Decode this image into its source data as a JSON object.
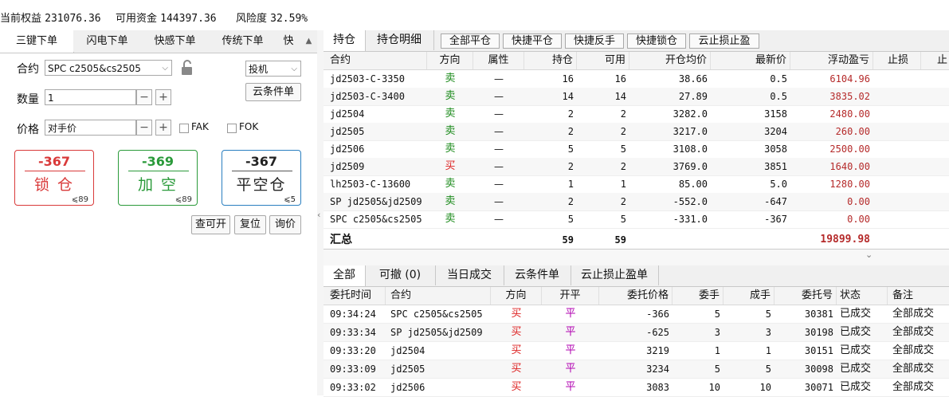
{
  "topbar": {
    "equity_label": "当前权益",
    "equity_value": "231076.36",
    "available_label": "可用资金",
    "available_value": "144397.36",
    "risk_label": "风险度",
    "risk_value": "32.59%"
  },
  "order_panel": {
    "tabs": [
      "三键下单",
      "闪电下单",
      "快感下单",
      "传统下单",
      "快"
    ],
    "contract_label": "合约",
    "contract_value": "SPC c2505&cs2505",
    "hedge_value": "投机",
    "cloud_button": "云条件单",
    "qty_label": "数量",
    "qty_value": "1",
    "price_label": "价格",
    "price_value": "对手价",
    "fak_label": "FAK",
    "fok_label": "FOK",
    "lock_btn": {
      "price": "-367",
      "name": "锁 仓",
      "qty": "⩽89"
    },
    "short_btn": {
      "price": "-369",
      "name": "加 空",
      "qty": "⩽89"
    },
    "close_btn": {
      "price": "-367",
      "name": "平空仓",
      "qty": "⩽5"
    },
    "check_button": "查可开",
    "reset_button": "复位",
    "query_button": "询价",
    "colors": {
      "lock": "#d93a3a",
      "short": "#2a9a3a",
      "close": "#2a7fc0"
    }
  },
  "positions": {
    "tabs": [
      "持仓",
      "持仓明细"
    ],
    "toolbar": [
      "全部平仓",
      "快捷平仓",
      "快捷反手",
      "快捷锁仓",
      "云止损止盈"
    ],
    "headers": [
      "合约",
      "方向",
      "属性",
      "持仓",
      "可用",
      "开仓均价",
      "最新价",
      "浮动盈亏",
      "止损",
      "止"
    ],
    "rows": [
      {
        "contract": "jd2503-C-3350",
        "dir": "卖",
        "attr": "—",
        "pos": "16",
        "avail": "16",
        "avg": "38.66",
        "last": "0.5",
        "pnl": "6104.96"
      },
      {
        "contract": "jd2503-C-3400",
        "dir": "卖",
        "attr": "—",
        "pos": "14",
        "avail": "14",
        "avg": "27.89",
        "last": "0.5",
        "pnl": "3835.02"
      },
      {
        "contract": "jd2504",
        "dir": "卖",
        "attr": "—",
        "pos": "2",
        "avail": "2",
        "avg": "3282.0",
        "last": "3158",
        "pnl": "2480.00"
      },
      {
        "contract": "jd2505",
        "dir": "卖",
        "attr": "—",
        "pos": "2",
        "avail": "2",
        "avg": "3217.0",
        "last": "3204",
        "pnl": "260.00"
      },
      {
        "contract": "jd2506",
        "dir": "卖",
        "attr": "—",
        "pos": "5",
        "avail": "5",
        "avg": "3108.0",
        "last": "3058",
        "pnl": "2500.00"
      },
      {
        "contract": "jd2509",
        "dir": "买",
        "attr": "—",
        "pos": "2",
        "avail": "2",
        "avg": "3769.0",
        "last": "3851",
        "pnl": "1640.00"
      },
      {
        "contract": "lh2503-C-13600",
        "dir": "卖",
        "attr": "—",
        "pos": "1",
        "avail": "1",
        "avg": "85.00",
        "last": "5.0",
        "pnl": "1280.00"
      },
      {
        "contract": "SP jd2505&jd2509",
        "dir": "卖",
        "attr": "—",
        "pos": "2",
        "avail": "2",
        "avg": "-552.0",
        "last": "-647",
        "pnl": "0.00"
      },
      {
        "contract": "SPC c2505&cs2505",
        "dir": "卖",
        "attr": "—",
        "pos": "5",
        "avail": "5",
        "avg": "-331.0",
        "last": "-367",
        "pnl": "0.00"
      }
    ],
    "summary": {
      "label": "汇总",
      "pos": "59",
      "avail": "59",
      "pnl": "19899.98"
    }
  },
  "orders": {
    "tabs": [
      "全部",
      "可撤 (0)",
      "当日成交",
      "云条件单",
      "云止损止盈单"
    ],
    "headers": [
      "委托时间",
      "合约",
      "方向",
      "开平",
      "委托价格",
      "委手",
      "成手",
      "委托号",
      "状态",
      "备注"
    ],
    "rows": [
      {
        "time": "09:34:24",
        "contract": "SPC c2505&cs2505",
        "dir": "买",
        "kp": "平",
        "price": "-366",
        "vol": "5",
        "filled": "5",
        "id": "30381",
        "status": "已成交",
        "note": "全部成交"
      },
      {
        "time": "09:33:34",
        "contract": "SP jd2505&jd2509",
        "dir": "买",
        "kp": "平",
        "price": "-625",
        "vol": "3",
        "filled": "3",
        "id": "30198",
        "status": "已成交",
        "note": "全部成交"
      },
      {
        "time": "09:33:20",
        "contract": "jd2504",
        "dir": "买",
        "kp": "平",
        "price": "3219",
        "vol": "1",
        "filled": "1",
        "id": "30151",
        "status": "已成交",
        "note": "全部成交"
      },
      {
        "time": "09:33:09",
        "contract": "jd2505",
        "dir": "买",
        "kp": "平",
        "price": "3234",
        "vol": "5",
        "filled": "5",
        "id": "30098",
        "status": "已成交",
        "note": "全部成交"
      },
      {
        "time": "09:33:02",
        "contract": "jd2506",
        "dir": "买",
        "kp": "平",
        "price": "3083",
        "vol": "10",
        "filled": "10",
        "id": "30071",
        "status": "已成交",
        "note": "全部成交"
      }
    ]
  }
}
